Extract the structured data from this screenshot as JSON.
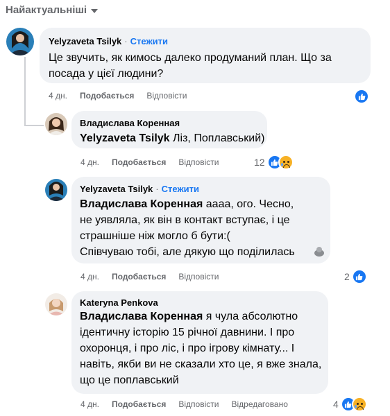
{
  "sort": {
    "label": "Найактуальніші"
  },
  "comments": [
    {
      "author": "Yelyzaveta Tsilyk",
      "follow": "Стежити",
      "text": "Це звучить, як кимось далеко продуманий план. Що за посада у цієї людини?",
      "time": "4 дн.",
      "like": "Подобається",
      "reply": "Відповісти",
      "reactions": {
        "types": [
          "like"
        ],
        "count": ""
      }
    },
    {
      "author": "Владислава Коренная",
      "mention": "Yelyzaveta Tsilyk",
      "text": "Ліз, Поплавський)",
      "time": "4 дн.",
      "like": "Подобається",
      "reply": "Відповісти",
      "reactions": {
        "types": [
          "like",
          "sad"
        ],
        "count": "12"
      }
    },
    {
      "author": "Yelyzaveta Tsilyk",
      "follow": "Стежити",
      "mention": "Владислава Коренная",
      "text": "аааа, ого. Чесно, не уявляла, як він в контакт вступає, і це страшніше ніж могло б бути:(\nСпівчуваю тобі, але дякую що поділилась",
      "time": "4 дн.",
      "like": "Подобається",
      "reply": "Відповісти",
      "reactions": {
        "types": [
          "like"
        ],
        "count": "2"
      }
    },
    {
      "author": "Kateryna Penkova",
      "mention": "Владислава Коренная",
      "text": "я чула абсолютно ідентичну історію 15 річної давнини. І про охоронця, і про ліс, і про ігрову кімнату... І навіть, якби ви не сказали хто це, я вже знала, що це поплавський",
      "time": "4 дн.",
      "like": "Подобається",
      "reply": "Відповісти",
      "edited": "Відредаговано",
      "reactions": {
        "types": [
          "like",
          "sad"
        ],
        "count": "4"
      }
    }
  ],
  "colors": {
    "accent": "#1877f2",
    "bubble": "#f0f2f5",
    "muted": "#65676b"
  }
}
